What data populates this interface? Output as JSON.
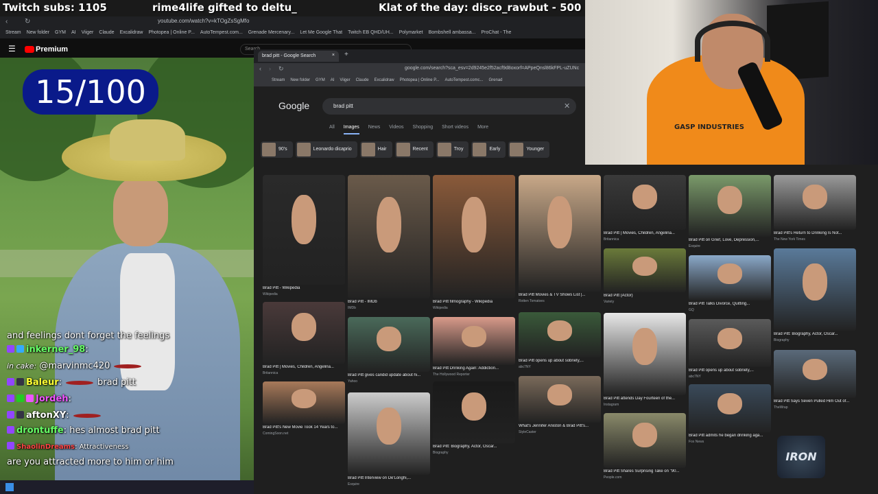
{
  "banner": {
    "subs": "Twitch subs: 1105",
    "gift": "rime4life gifted to deltu_",
    "klat": "Klat of the day: disco_rawbut - 500"
  },
  "outer_browser": {
    "url": "youtube.com/watch?v=kTOgZsSgMfo",
    "bookmarks": [
      "Stream",
      "New folder",
      "GYM",
      "AI",
      "Viiger",
      "Claude",
      "Excalidraw",
      "Photopea | Online P...",
      "AutoTempest.com...",
      "Grenade Mercenary...",
      "Let Me Google That",
      "Twitch EB QHD/UH...",
      "Polymarket",
      "Bombshell ambassa...",
      "ProChat - The"
    ]
  },
  "youtube": {
    "brand": "Premium",
    "search_placeholder": "Search"
  },
  "counter": "15/100",
  "chat": [
    {
      "user": "",
      "text": "and feelings dont forget the feelings"
    },
    {
      "user": "inkerner_98",
      "text": ":"
    },
    {
      "user": "@marvinmc420",
      "prefix": "in cake:",
      "text": ""
    },
    {
      "user": "Baleur",
      "text": "brad pitt"
    },
    {
      "user": "Jordeh",
      "text": ":"
    },
    {
      "user": "aftonXY",
      "text": ":"
    },
    {
      "user": "drontuffe",
      "text": "hes almost brad pitt"
    },
    {
      "user": "ShaolinDreams",
      "text": "Attractiveness"
    },
    {
      "user": "",
      "text": "are you attracted more to him or him"
    }
  ],
  "inner_browser": {
    "tab_title": "brad pitt - Google Search",
    "url": "google.com/search?sca_esv=2d9245e2f52acf9d8oxorf=APpeQnsl86kFPL-uZUNc",
    "bookmarks": [
      "Stream",
      "New folder",
      "GYM",
      "AI",
      "Viiger",
      "Claude",
      "Excalidraw",
      "Photopea | Online P...",
      "AutoTempest.comc...",
      "Grenad"
    ]
  },
  "google": {
    "logo": "Google",
    "query": "brad pitt",
    "tabs": [
      "All",
      "Images",
      "News",
      "Videos",
      "Shopping",
      "Short videos",
      "More"
    ],
    "active_tab": "Images",
    "chips": [
      "90's",
      "Leonardo dicaprio",
      "Hair",
      "Recent",
      "Troy",
      "Early",
      "Younger"
    ],
    "results": [
      {
        "title": "Brad Pitt - Wikipedia",
        "source": "Wikipedia",
        "color": "#2a2a2a"
      },
      {
        "title": "Brad Pitt - IMDb",
        "source": "IMDb",
        "color": "#6a5a4a"
      },
      {
        "title": "Brad Pitt filmography - Wikipedia",
        "source": "Wikipedia",
        "color": "#8a5a3a"
      },
      {
        "title": "Brad Pitt Movies & TV Shows List |...",
        "source": "Rotten Tomatoes",
        "color": "#c8a888"
      },
      {
        "title": "Brad Pitt | Movies, Children, Angelina...",
        "source": "Britannica",
        "color": "#3a3a3a"
      },
      {
        "title": "Brad Pitt on Grief, Love, Depression,...",
        "source": "Esquire",
        "color": "#7a9a6a"
      },
      {
        "title": "Brad Pitt's Return to Drinking Is Not...",
        "source": "The New York Times",
        "color": "#9a9a9a"
      },
      {
        "title": "Brad Pitt (Actor)",
        "source": "Variety",
        "color": "#6a7a3a"
      },
      {
        "title": "Brad Pitt Talks Divorce, Quitting...",
        "source": "GQ",
        "color": "#8aa8c8"
      },
      {
        "title": "Brad Pitt | Movies, Children, Angelina...",
        "source": "Britannica",
        "color": "#4a3a3a"
      },
      {
        "title": "Brad Pitt gives candid update about hi...",
        "source": "Yahoo",
        "color": "#4a6a5a"
      },
      {
        "title": "Brad Pitt Drinking Again: Addiction...",
        "source": "The Hollywood Reporter",
        "color": "#d89a8a"
      },
      {
        "title": "Brad Pitt opens up about sobriety,...",
        "source": "abc7NY",
        "color": "#3a5a3a"
      },
      {
        "title": "Brad Pitt: Biography, Actor, Oscar...",
        "source": "Biography",
        "color": "#5a7a9a"
      },
      {
        "title": "Brad Pitt attends Day Fourteen of the...",
        "source": "Instagram",
        "color": "#e8e8e8"
      },
      {
        "title": "Brad Pitt opens up about sobriety,...",
        "source": "abc7NY",
        "color": "#5a5a5a"
      },
      {
        "title": "Brad Pitt's New Movie Took 14 Years to...",
        "source": "ComingSoon.net",
        "color": "#a87a5a"
      },
      {
        "title": "Brad Pitt Interview on De'Longhi,...",
        "source": "Esquire",
        "color": "#ccc"
      },
      {
        "title": "Brad Pitt: Biography, Actor, Oscar...",
        "source": "Biography",
        "color": "#1a1a1a"
      },
      {
        "title": "What's Jennifer Aniston & Brad Pitt's...",
        "source": "StyleCaster",
        "color": "#7a6a5a"
      },
      {
        "title": "Brad Pitt Says Seven Pulled Him Out of...",
        "source": "TheWrap",
        "color": "#5a6a7a"
      },
      {
        "title": "Brad Pitt admits he began drinking aga...",
        "source": "Fox News",
        "color": "#3a4a5a"
      },
      {
        "title": "Brad Pitt Shares Surprising Take on \"90...",
        "source": "People.com",
        "color": "#8a8a6a"
      }
    ],
    "badge_licensable": "Licensable",
    "badge_time": "17 hours ago",
    "badge_day": "a day ago",
    "badge_video": "Video"
  },
  "webcam": {
    "shirt_text": "GASP INDUSTRIES"
  },
  "overlay_logo": "IRON"
}
